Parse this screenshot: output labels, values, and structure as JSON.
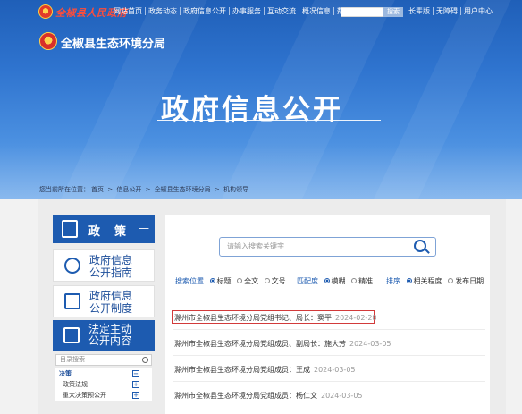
{
  "top": {
    "site_name": "全椒县人民政府",
    "nav_left": [
      "网站首页",
      "政务动态",
      "政府信息公开",
      "办事服务",
      "互动交流",
      "概况信息",
      "数据发布"
    ],
    "search_button": "搜索",
    "nav_right": [
      "长辈版",
      "无障碍",
      "用户中心"
    ]
  },
  "header": {
    "bureau": "全椒县生态环境分局",
    "banner": "政府信息公开"
  },
  "breadcrumb": {
    "prefix": "您当前所在位置：",
    "items": [
      "首页",
      "信息公开",
      "全椒县生态环境分局",
      "机构领导"
    ],
    "sep": ">"
  },
  "sidebar": {
    "head_label": "政策",
    "head_dash": "—",
    "item1_l1": "政府信息",
    "item1_l2": "公开指南",
    "item2_l1": "政府信息",
    "item2_l2": "公开制度",
    "active_l1": "法定主动",
    "active_l2": "公开内容",
    "active_dash": "—",
    "dir_search_placeholder": "目录搜索",
    "tree": [
      {
        "label": "决策",
        "type": "cat",
        "sign": "−"
      },
      {
        "label": "政策法规",
        "type": "leaf",
        "sign": "+"
      },
      {
        "label": "重大决策预公开",
        "type": "leaf",
        "sign": "+"
      }
    ]
  },
  "search": {
    "placeholder": "请输入搜索关键字"
  },
  "filters": {
    "pos_label": "搜索位置",
    "pos_opts": [
      "标题",
      "全文",
      "文号"
    ],
    "match_label": "匹配度",
    "match_opts": [
      "模糊",
      "精准"
    ],
    "sort_label": "排序",
    "sort_opts": [
      "相关程度",
      "发布日期"
    ]
  },
  "results": [
    {
      "title": "滁州市全椒县生态环境分局党组书记、局长：窦平",
      "date": "2024-02-28"
    },
    {
      "title": "滁州市全椒县生态环境分局党组成员、副局长：施大芳",
      "date": "2024-03-05"
    },
    {
      "title": "滁州市全椒县生态环境分局党组成员：王成",
      "date": "2024-03-05"
    },
    {
      "title": "滁州市全椒县生态环境分局党组成员：杨仁文",
      "date": "2024-03-05"
    }
  ],
  "colors": {
    "primary": "#1d5bb0",
    "highlight": "#d23a3a"
  }
}
